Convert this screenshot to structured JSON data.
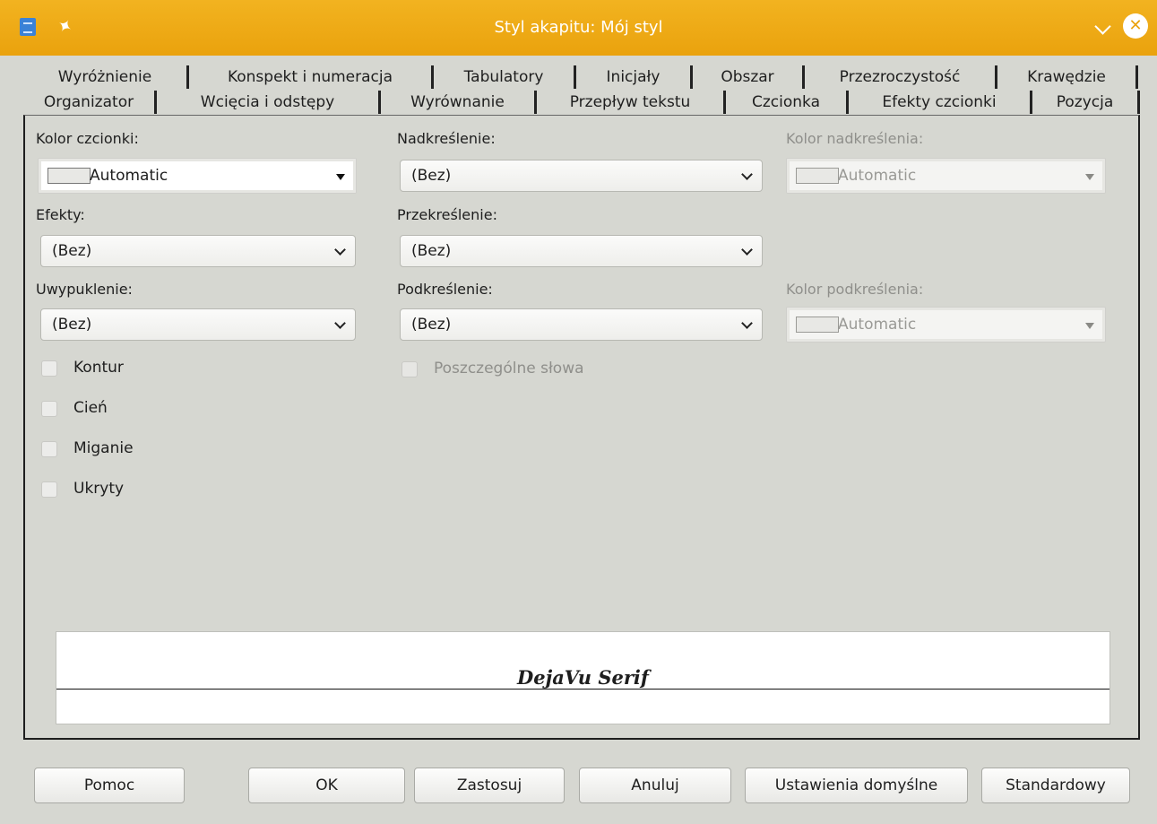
{
  "window": {
    "title": "Styl akapitu: Mój styl"
  },
  "tabs": {
    "row1": [
      "Wyróżnienie",
      "Konspekt i numeracja",
      "Tabulatory",
      "Inicjały",
      "Obszar",
      "Przezroczystość",
      "Krawędzie"
    ],
    "row2": [
      "Organizator",
      "Wcięcia i odstępy",
      "Wyrównanie",
      "Przepływ tekstu",
      "Czcionka",
      "Efekty czcionki",
      "Pozycja"
    ],
    "active": "Efekty czcionki"
  },
  "fields": {
    "font_color": {
      "label": "Kolor czcionki:",
      "value": "Automatic"
    },
    "overline": {
      "label": "Nadkreślenie:",
      "value": "(Bez)"
    },
    "overline_color": {
      "label": "Kolor nadkreślenia:",
      "value": "Automatic"
    },
    "effects": {
      "label": "Efekty:",
      "value": "(Bez)"
    },
    "strikethrough": {
      "label": "Przekreślenie:",
      "value": "(Bez)"
    },
    "relief": {
      "label": "Uwypuklenie:",
      "value": "(Bez)"
    },
    "underline": {
      "label": "Podkreślenie:",
      "value": "(Bez)"
    },
    "underline_color": {
      "label": "Kolor podkreślenia:",
      "value": "Automatic"
    }
  },
  "checkboxes": {
    "outline": "Kontur",
    "shadow": "Cień",
    "blinking": "Miganie",
    "hidden": "Ukryty",
    "individual_words": "Poszczególne słowa"
  },
  "preview": {
    "text": "DejaVu Serif"
  },
  "buttons": {
    "help": "Pomoc",
    "ok": "OK",
    "apply": "Zastosuj",
    "cancel": "Anuluj",
    "reset": "Ustawienia domyślne",
    "standard": "Standardowy"
  },
  "colors": {
    "titlebar": "#eaa20d",
    "background": "#d6d7d1"
  }
}
